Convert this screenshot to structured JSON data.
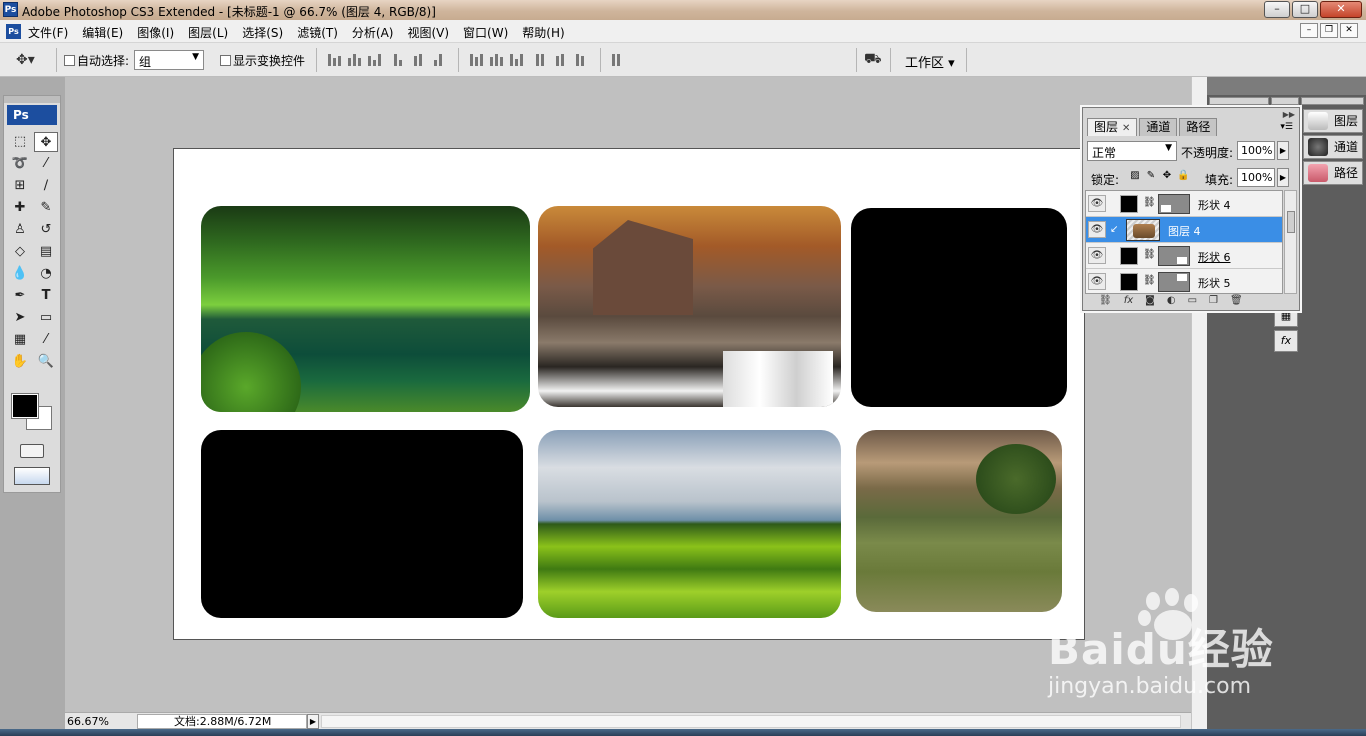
{
  "titlebar": {
    "title": "Adobe Photoshop CS3 Extended - [未标题-1 @ 66.7% (图层 4, RGB/8)]",
    "app_icon": "Ps"
  },
  "menubar": {
    "items": [
      "文件(F)",
      "编辑(E)",
      "图像(I)",
      "图层(L)",
      "选择(S)",
      "滤镜(T)",
      "分析(A)",
      "视图(V)",
      "窗口(W)",
      "帮助(H)"
    ]
  },
  "options_bar": {
    "auto_select_label": "自动选择:",
    "auto_select_value": "组",
    "show_transform_label": "显示变换控件",
    "workspace_label": "工作区"
  },
  "toolbox": {
    "logo": "Ps",
    "tools": [
      "marquee-icon",
      "move-icon",
      "lasso-icon",
      "magic-wand-icon",
      "crop-icon",
      "slice-icon",
      "healing-brush-icon",
      "brush-icon",
      "clone-stamp-icon",
      "history-brush-icon",
      "eraser-icon",
      "gradient-icon",
      "blur-icon",
      "dodge-icon",
      "pen-icon",
      "type-icon",
      "path-selection-icon",
      "shape-icon",
      "notes-icon",
      "eyedropper-icon",
      "hand-icon",
      "zoom-icon"
    ],
    "foreground_color": "#000000",
    "background_color": "#ffffff"
  },
  "canvas": {
    "tiles": [
      {
        "name": "tile-forest-lake",
        "kind": "photo"
      },
      {
        "name": "tile-mill-waterfall",
        "kind": "photo"
      },
      {
        "name": "tile-empty-shape-1",
        "kind": "black"
      },
      {
        "name": "tile-empty-shape-2",
        "kind": "black"
      },
      {
        "name": "tile-green-hills",
        "kind": "photo"
      },
      {
        "name": "tile-hillside-tree",
        "kind": "photo"
      }
    ]
  },
  "statusbar": {
    "zoom": "66.67%",
    "docinfo": "文档:2.88M/6.72M"
  },
  "side_panels": {
    "items": [
      "图层",
      "通道",
      "路径"
    ]
  },
  "layers_panel": {
    "tabs": [
      "图层",
      "通道",
      "路径"
    ],
    "blend_mode": "正常",
    "opacity_label": "不透明度:",
    "opacity_value": "100%",
    "lock_label": "锁定:",
    "fill_label": "填充:",
    "fill_value": "100%",
    "layers": [
      {
        "name": "形状 4",
        "type": "shape",
        "selected": false
      },
      {
        "name": "图层 4",
        "type": "pixel",
        "selected": true
      },
      {
        "name": "形状 6",
        "type": "shape",
        "selected": false
      },
      {
        "name": "形状 5",
        "type": "shape",
        "selected": false
      }
    ],
    "footer_icons": [
      "link-layers-icon",
      "fx-icon",
      "mask-icon",
      "adjustment-icon",
      "group-icon",
      "new-layer-icon",
      "trash-icon"
    ]
  },
  "watermark": {
    "brand": "Bai",
    "brand_mid": "du",
    "brand_cn": "经验",
    "url": "jingyan.baidu.com"
  }
}
